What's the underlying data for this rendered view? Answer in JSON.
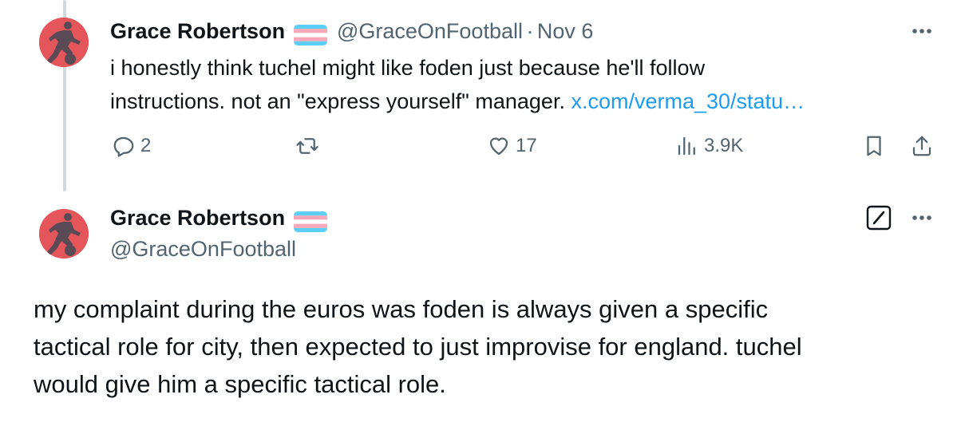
{
  "tweet1": {
    "author_name": "Grace Robertson",
    "handle": "@GraceOnFootball",
    "separator": "·",
    "date": "Nov 6",
    "text_line1": "i honestly think tuchel might like foden just because he'll follow",
    "text_line2": "instructions. not an \"express yourself\" manager. ",
    "link_text": "x.com/verma_30/statu…",
    "actions": {
      "replies": "2",
      "retweets": "",
      "likes": "17",
      "views": "3.9K"
    },
    "icons": [
      "reply-icon",
      "retweet-icon",
      "like-icon",
      "views-icon",
      "bookmark-icon",
      "share-icon",
      "more-icon"
    ]
  },
  "tweet2": {
    "author_name": "Grace Robertson",
    "handle": "@GraceOnFootball",
    "text_line1": "my complaint during the euros was foden is always given a specific",
    "text_line2": "tactical role for city, then expected to just improvise for england. tuchel",
    "text_line3": "would give him a specific tactical role.",
    "icons": [
      "grok-icon",
      "more-icon"
    ]
  },
  "colors": {
    "text": "#0f1419",
    "muted": "#536471",
    "link": "#1d9bf0",
    "thread_line": "#cfd9de",
    "avatar_bg": "#e5565a",
    "flag_blue": "#5bcefa",
    "flag_pink": "#f5a9b8"
  }
}
